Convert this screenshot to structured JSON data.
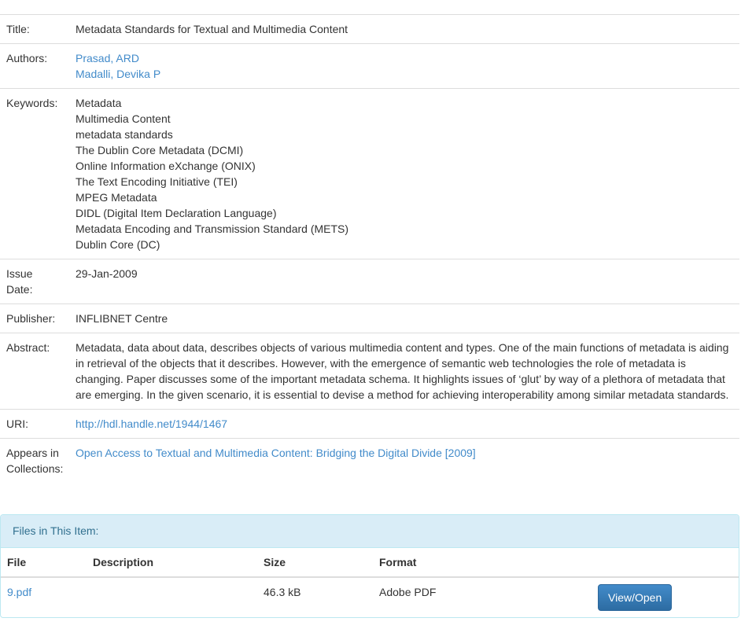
{
  "metadata": {
    "title_label": "Title:",
    "title_value": "Metadata Standards for Textual and Multimedia Content",
    "authors_label": "Authors:",
    "authors": [
      "Prasad, ARD",
      "Madalli, Devika P"
    ],
    "keywords_label": "Keywords:",
    "keywords": [
      "Metadata",
      "Multimedia Content",
      "metadata standards",
      "The Dublin Core Metadata (DCMI)",
      "Online Information eXchange (ONIX)",
      "The Text Encoding Initiative (TEI)",
      "MPEG Metadata",
      "DIDL (Digital Item Declaration Language)",
      "Metadata Encoding and Transmission Standard (METS)",
      "Dublin Core (DC)"
    ],
    "issue_date_label_1": "Issue",
    "issue_date_label_2": "Date:",
    "issue_date_value": "29-Jan-2009",
    "publisher_label": "Publisher:",
    "publisher_value": "INFLIBNET Centre",
    "abstract_label": "Abstract:",
    "abstract_value": "Metadata, data about data, describes objects of various multimedia content and types. One of the main functions of metadata is aiding in retrieval of the objects that it describes. However, with the emergence of semantic web technologies the role of metadata is changing. Paper discusses some of the important metadata schema. It highlights issues of ‘glut’ by way of a plethora of metadata that are emerging. In the given scenario, it is essential to devise a method for achieving interoperability among similar metadata standards.",
    "uri_label": "URI:",
    "uri_value": "http://hdl.handle.net/1944/1467",
    "collections_label_1": "Appears in",
    "collections_label_2": "Collections:",
    "collections_value": "Open Access to Textual and Multimedia Content: Bridging the Digital Divide [2009]"
  },
  "files": {
    "heading": "Files in This Item:",
    "columns": {
      "file": "File",
      "description": "Description",
      "size": "Size",
      "format": "Format"
    },
    "rows": [
      {
        "file": "9.pdf",
        "description": "",
        "size": "46.3 kB",
        "format": "Adobe PDF",
        "action": "View/Open"
      }
    ]
  },
  "colors": {
    "link": "#428bca",
    "panel_heading_bg": "#d9edf7",
    "panel_heading_text": "#31708f",
    "button_bg": "#337ab7"
  }
}
